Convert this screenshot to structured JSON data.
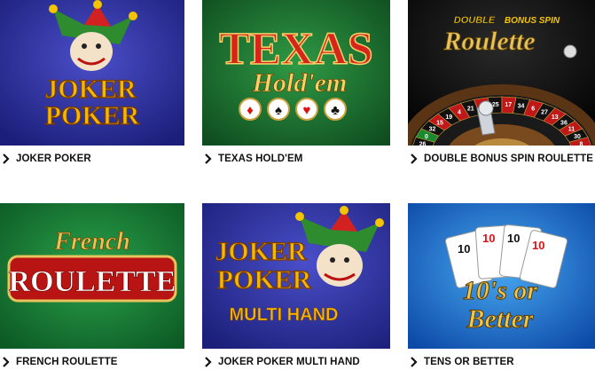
{
  "games": [
    {
      "title": "JOKER POKER",
      "art": [
        "JOKER",
        "POKER"
      ]
    },
    {
      "title": "TEXAS HOLD'EM",
      "art": [
        "TEXAS",
        "Hold'em"
      ]
    },
    {
      "title": "DOUBLE BONUS SPIN ROULETTE",
      "art": [
        "DOUBLE",
        "BONUS SPIN",
        "Roulette"
      ]
    },
    {
      "title": "FRENCH ROULETTE",
      "art": [
        "French",
        "ROULETTE"
      ]
    },
    {
      "title": "JOKER POKER MULTI HAND",
      "art": [
        "JOKER",
        "POKER",
        "MULTI HAND"
      ]
    },
    {
      "title": "TENS OR BETTER",
      "art": [
        "10's or",
        "Better"
      ]
    }
  ],
  "roulette_numbers": [
    "3",
    "26",
    "0",
    "32",
    "15",
    "19",
    "4",
    "21",
    "2",
    "25",
    "17",
    "34",
    "6",
    "27",
    "13",
    "36",
    "11",
    "30",
    "8",
    "23"
  ],
  "card_ranks": [
    "10",
    "10",
    "10",
    "10"
  ],
  "suits": [
    "♦",
    "♠",
    "♥",
    "♣"
  ],
  "icons": {
    "caption_arrow": "chevron-right-icon"
  }
}
